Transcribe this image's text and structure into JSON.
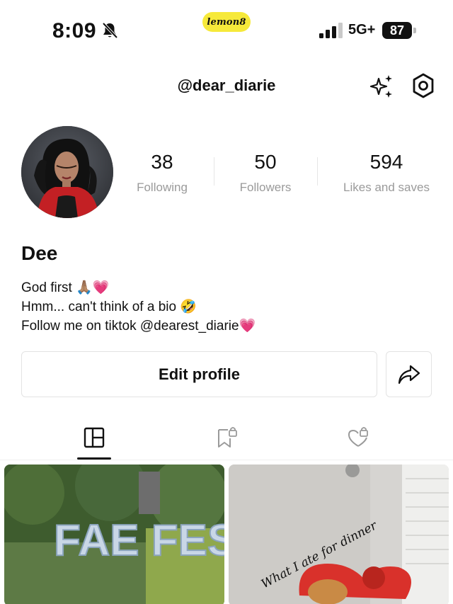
{
  "status_bar": {
    "time": "8:09",
    "brand": "lemon8",
    "network": "5G+",
    "battery": "87"
  },
  "header": {
    "handle": "@dear_diarie"
  },
  "stats": [
    {
      "value": "38",
      "label": "Following"
    },
    {
      "value": "50",
      "label": "Followers"
    },
    {
      "value": "594",
      "label": "Likes and saves"
    }
  ],
  "profile": {
    "name": "Dee",
    "bio": [
      "God first 🙏🏽💗",
      "Hmm... can't think of a bio 🤣",
      "Follow me on tiktok @dearest_diarie💗"
    ]
  },
  "actions": {
    "edit_label": "Edit profile"
  },
  "tabs": [
    {
      "icon": "grid-icon",
      "active": true
    },
    {
      "icon": "bookmark-lock-icon",
      "active": false
    },
    {
      "icon": "heart-lock-icon",
      "active": false
    }
  ],
  "posts": [
    {
      "caption": "FAE FEST"
    },
    {
      "caption": "What I ate for dinner"
    }
  ],
  "colors": {
    "brand_yellow": "#f6e93a",
    "muted_text": "#9a9a9a",
    "border": "#e3e3e3"
  }
}
